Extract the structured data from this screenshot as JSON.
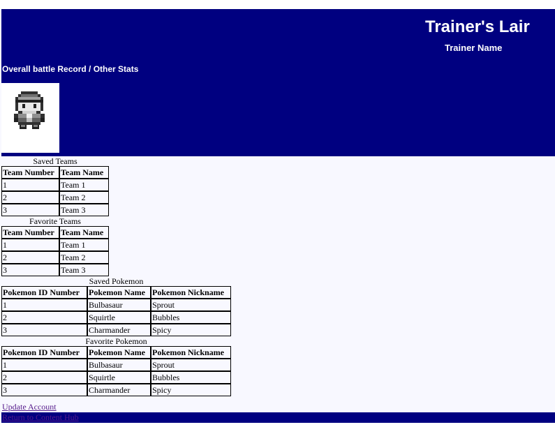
{
  "colors": {
    "header_bg": "#000080",
    "header_text": "#ffffff",
    "page_bg": "#f8f8ff",
    "link": "#551a8b"
  },
  "header": {
    "title": "Trainer's Lair",
    "trainer_name": "Trainer Name",
    "stats_heading": "Overall battle Record / Other Stats",
    "avatar_icon": "pixel-trainer-sprite-icon"
  },
  "saved_teams": {
    "caption": "Saved Teams",
    "columns": [
      "Team Number",
      "Team Name"
    ],
    "rows": [
      [
        "1",
        "Team 1"
      ],
      [
        "2",
        "Team 2"
      ],
      [
        "3",
        "Team 3"
      ]
    ]
  },
  "favorite_teams": {
    "caption": "Favorite Teams",
    "columns": [
      "Team Number",
      "Team Name"
    ],
    "rows": [
      [
        "1",
        "Team 1"
      ],
      [
        "2",
        "Team 2"
      ],
      [
        "3",
        "Team 3"
      ]
    ]
  },
  "saved_pokemon": {
    "caption": "Saved Pokemon",
    "columns": [
      "Pokemon ID Number",
      "Pokemon Name",
      "Pokemon Nickname"
    ],
    "rows": [
      [
        "1",
        "Bulbasaur",
        "Sprout"
      ],
      [
        "2",
        "Squirtle",
        "Bubbles"
      ],
      [
        "3",
        "Charmander",
        "Spicy"
      ]
    ]
  },
  "favorite_pokemon": {
    "caption": "Favorite Pokemon",
    "columns": [
      "Pokemon ID Number",
      "Pokemon Name",
      "Pokemon Nickname"
    ],
    "rows": [
      [
        "1",
        "Bulbasaur",
        "Sprout"
      ],
      [
        "2",
        "Squirtle",
        "Bubbles"
      ],
      [
        "3",
        "Charmander",
        "Spicy"
      ]
    ]
  },
  "links": {
    "update_account": "Update Account",
    "return_hub": "Return to Content Hub"
  }
}
